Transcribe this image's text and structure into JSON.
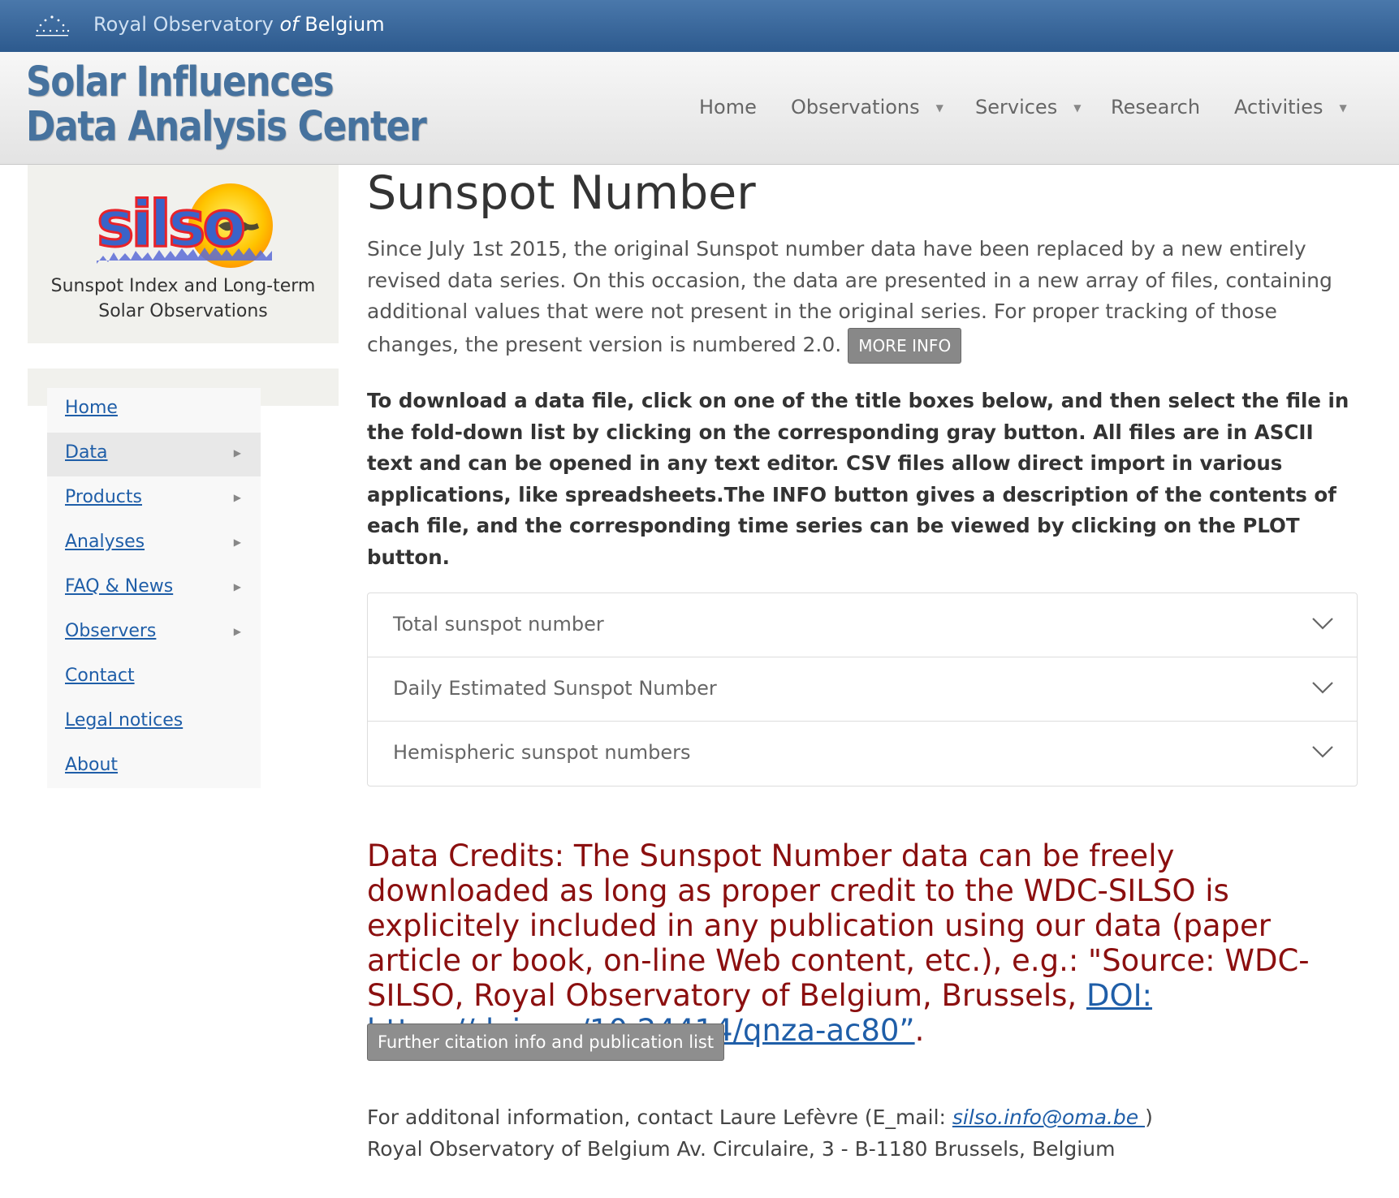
{
  "topbar": {
    "org_prefix": "Royal Observatory ",
    "org_of": "of",
    "org_suffix": " Belgium",
    "icon": "stars-logo-icon"
  },
  "header": {
    "title_line1": "Solar Influences",
    "title_line2": "Data Analysis Center",
    "nav": [
      {
        "label": "Home",
        "has_dropdown": false
      },
      {
        "label": "Observations",
        "has_dropdown": true
      },
      {
        "label": "Services",
        "has_dropdown": true
      },
      {
        "label": "Research",
        "has_dropdown": false
      },
      {
        "label": "Activities",
        "has_dropdown": true
      }
    ],
    "dropdown_glyph": "▼"
  },
  "sidebar": {
    "logo_text": "silso",
    "logo_caption_line1": "Sunspot Index and Long-term",
    "logo_caption_line2": "Solar Observations",
    "submenu_glyph": "▶",
    "menu": [
      {
        "label": "Home",
        "has_submenu": false,
        "active": false
      },
      {
        "label": "Data",
        "has_submenu": true,
        "active": true
      },
      {
        "label": "Products",
        "has_submenu": true,
        "active": false
      },
      {
        "label": "Analyses",
        "has_submenu": true,
        "active": false
      },
      {
        "label": "FAQ & News",
        "has_submenu": true,
        "active": false
      },
      {
        "label": "Observers",
        "has_submenu": true,
        "active": false
      },
      {
        "label": "Contact",
        "has_submenu": false,
        "active": false
      },
      {
        "label": "Legal notices",
        "has_submenu": false,
        "active": false
      },
      {
        "label": "About",
        "has_submenu": false,
        "active": false
      }
    ]
  },
  "main": {
    "title": "Sunspot Number",
    "intro": "Since July 1st 2015, the original Sunspot number data have been replaced by a new entirely revised data series. On this occasion, the data are presented in a new array of files, containing additional values that were not present in the original series. For proper tracking of those changes, the present version is numbered 2.0.",
    "more_info_label": "MORE INFO",
    "instructions": "To download a data file, click on one of the title boxes below, and then select the file in the fold-down list by clicking on the corresponding gray button. All files are in ASCII text and can be opened in any text editor. CSV files allow direct import in various applications, like spreadsheets.The INFO button gives a description of the contents of each file, and the corresponding time series can be viewed by clicking on the PLOT button.",
    "accordion": [
      {
        "label": "Total sunspot number"
      },
      {
        "label": "Daily Estimated Sunspot Number"
      },
      {
        "label": "Hemispheric sunspot numbers"
      }
    ],
    "credits_text": "Data Credits: The Sunspot Number data can be freely downloaded as long as proper credit to the WDC-SILSO is explicitely included in any publication using our data (paper article or book, on-line Web content, etc.), e.g.: \"Source: WDC-SILSO, Royal Observatory of Belgium, Brussels, ",
    "credits_link": "DOI: https://doi.org/10.24414/qnza-ac80”",
    "credits_end": ".",
    "citation_button": "Further citation info and publication list",
    "contact_line1_pre": "For additonal information, contact Laure Lefèvre (E_mail: ",
    "contact_email": "silso.info@oma.be ",
    "contact_line1_post": ")",
    "contact_line2": "Royal Observatory of Belgium Av. Circulaire, 3 - B-1180 Brussels, Belgium"
  },
  "colors": {
    "topbar": "#2d5a8e",
    "title": "#46729e",
    "link": "#1f5ea8",
    "credits": "#8b0f0f",
    "button": "#888888"
  }
}
